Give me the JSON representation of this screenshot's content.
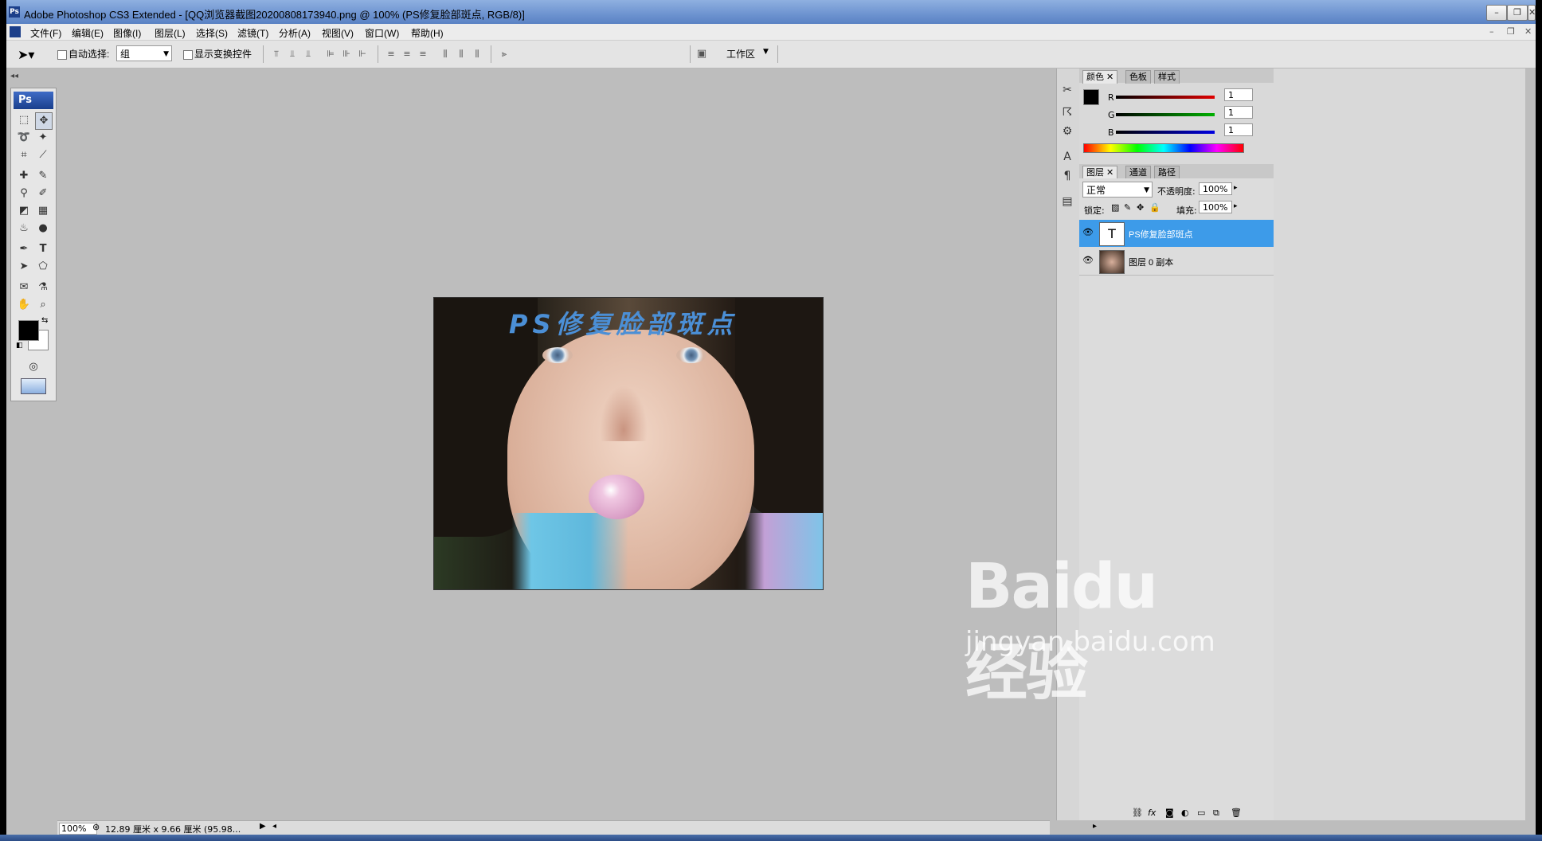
{
  "window": {
    "title": "Adobe Photoshop CS3 Extended - [QQ浏览器截图20200808173940.png @ 100% (PS修复脸部斑点, RGB/8)]",
    "app_icon": "Ps"
  },
  "menu": [
    "文件(F)",
    "编辑(E)",
    "图像(I)",
    "图层(L)",
    "选择(S)",
    "滤镜(T)",
    "分析(A)",
    "视图(V)",
    "窗口(W)",
    "帮助(H)"
  ],
  "options_bar": {
    "auto_select_label": "自动选择:",
    "auto_select_value": "组",
    "show_transform_label": "显示变换控件",
    "workspace_label": "工作区"
  },
  "document": {
    "overlay_text": "PS修复脸部斑点",
    "zoom": "100%",
    "doc_size": "12.89 厘米 x 9.66 厘米 (95.98..."
  },
  "toolbox": {
    "logo": "Ps"
  },
  "color_panel": {
    "tabs": [
      "颜色",
      "色板",
      "样式"
    ],
    "channels": [
      {
        "label": "R",
        "value": "1",
        "color": "#cc0000"
      },
      {
        "label": "G",
        "value": "1",
        "color": "#00a000"
      },
      {
        "label": "B",
        "value": "1",
        "color": "#0000c8"
      }
    ]
  },
  "layers_panel": {
    "tabs": [
      "图层",
      "通道",
      "路径"
    ],
    "blend_mode": "正常",
    "opacity_label": "不透明度:",
    "opacity_value": "100%",
    "lock_label": "锁定:",
    "fill_label": "填充:",
    "fill_value": "100%",
    "layers": [
      {
        "name": "PS修复脸部斑点",
        "kind": "T",
        "selected": true
      },
      {
        "name": "图层 0 副本",
        "kind": "image",
        "selected": false
      }
    ]
  },
  "watermark": {
    "brand": "Baidu经验",
    "url": "jingyan.baidu.com"
  },
  "colors": {
    "selection": "#3d9be9",
    "title_accent": "#4b8fd6"
  }
}
